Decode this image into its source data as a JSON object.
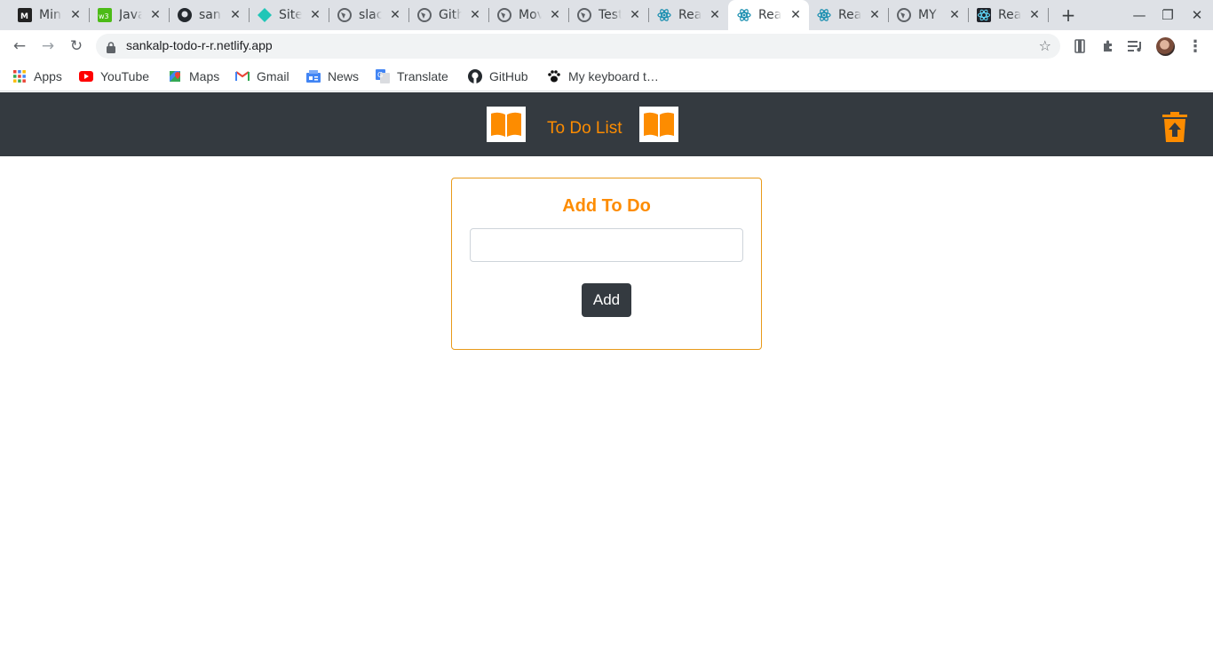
{
  "browser": {
    "tabs": [
      {
        "title": "Mini",
        "icon": "hackmd-icon"
      },
      {
        "title": "JavaScript",
        "icon": "code-icon"
      },
      {
        "title": "sankalp",
        "icon": "github-icon"
      },
      {
        "title": "Site",
        "icon": "netlify-icon"
      },
      {
        "title": "slack",
        "icon": "globe-icon"
      },
      {
        "title": "Github",
        "icon": "globe-icon"
      },
      {
        "title": "Movie",
        "icon": "globe-icon"
      },
      {
        "title": "Test",
        "icon": "globe-icon"
      },
      {
        "title": "React App",
        "icon": "react-icon"
      },
      {
        "title": "React App",
        "icon": "react-icon"
      },
      {
        "title": "React App",
        "icon": "react-icon"
      },
      {
        "title": "MY",
        "icon": "globe-icon"
      },
      {
        "title": "React App",
        "icon": "react-icon"
      }
    ],
    "active_tab_index": 9,
    "url": "sankalp-todo-r-r.netlify.app",
    "bookmarks": [
      {
        "label": "Apps",
        "icon": "apps-grid-icon"
      },
      {
        "label": "YouTube",
        "icon": "youtube-icon"
      },
      {
        "label": "Maps",
        "icon": "maps-icon"
      },
      {
        "label": "Gmail",
        "icon": "gmail-icon"
      },
      {
        "label": "News",
        "icon": "news-icon"
      },
      {
        "label": "Translate",
        "icon": "translate-icon"
      },
      {
        "label": "GitHub",
        "icon": "github-icon"
      },
      {
        "label": "My keyboard t…",
        "icon": "paw-icon"
      }
    ]
  },
  "app": {
    "title": "To Do List",
    "card_title": "Add To Do",
    "input_value": "",
    "add_label": "Add"
  },
  "colors": {
    "accent": "#fd8c00",
    "header_bg": "#343a40",
    "card_border": "#e89a1a"
  }
}
